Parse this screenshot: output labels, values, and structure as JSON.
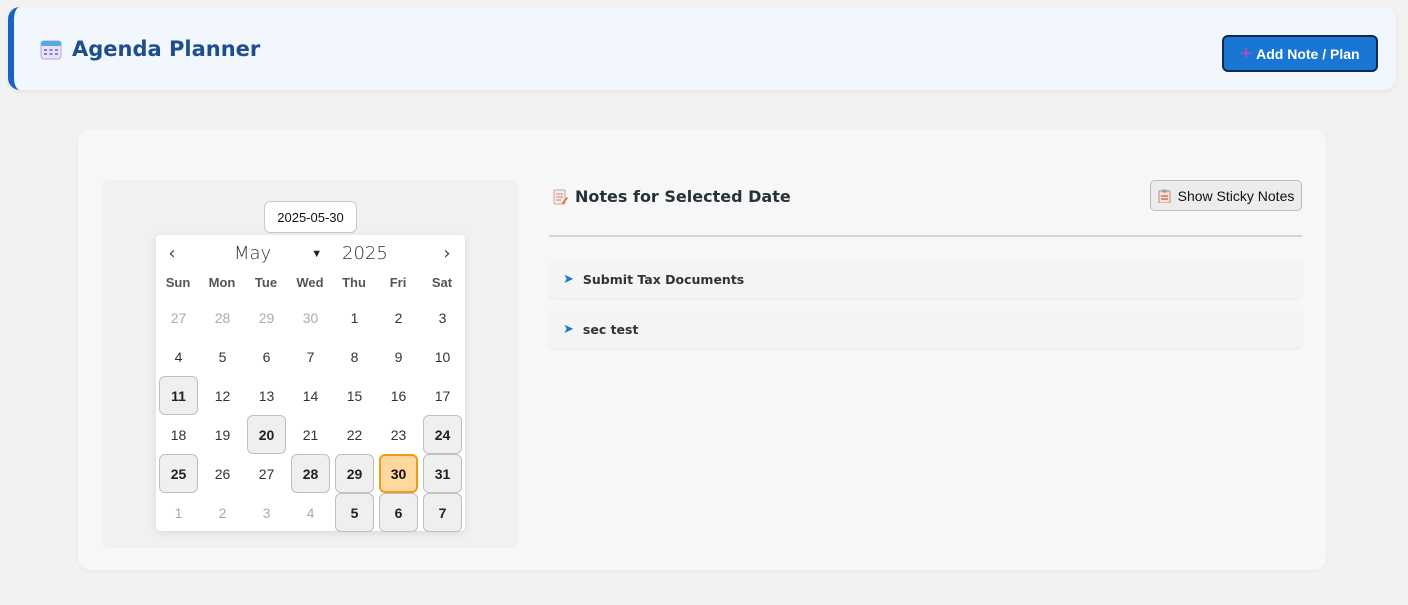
{
  "header": {
    "title": "Agenda Planner",
    "add_button_icon": "+",
    "add_button_label": "Add Note / Plan"
  },
  "calendar": {
    "date_input_value": "2025-05-30",
    "prev_icon": "‹",
    "next_icon": "›",
    "month": "May",
    "month_caret": "⌄",
    "year": "2025",
    "weekdays": [
      "Sun",
      "Mon",
      "Tue",
      "Wed",
      "Thu",
      "Fri",
      "Sat"
    ],
    "weeks": [
      [
        {
          "d": "27",
          "s": "muted"
        },
        {
          "d": "28",
          "s": "muted"
        },
        {
          "d": "29",
          "s": "muted"
        },
        {
          "d": "30",
          "s": "muted"
        },
        {
          "d": "1",
          "s": ""
        },
        {
          "d": "2",
          "s": ""
        },
        {
          "d": "3",
          "s": ""
        }
      ],
      [
        {
          "d": "4",
          "s": ""
        },
        {
          "d": "5",
          "s": ""
        },
        {
          "d": "6",
          "s": ""
        },
        {
          "d": "7",
          "s": ""
        },
        {
          "d": "8",
          "s": ""
        },
        {
          "d": "9",
          "s": ""
        },
        {
          "d": "10",
          "s": ""
        }
      ],
      [
        {
          "d": "11",
          "s": "marked"
        },
        {
          "d": "12",
          "s": ""
        },
        {
          "d": "13",
          "s": ""
        },
        {
          "d": "14",
          "s": ""
        },
        {
          "d": "15",
          "s": ""
        },
        {
          "d": "16",
          "s": ""
        },
        {
          "d": "17",
          "s": ""
        }
      ],
      [
        {
          "d": "18",
          "s": ""
        },
        {
          "d": "19",
          "s": ""
        },
        {
          "d": "20",
          "s": "marked"
        },
        {
          "d": "21",
          "s": ""
        },
        {
          "d": "22",
          "s": ""
        },
        {
          "d": "23",
          "s": ""
        },
        {
          "d": "24",
          "s": "marked"
        }
      ],
      [
        {
          "d": "25",
          "s": "marked"
        },
        {
          "d": "26",
          "s": ""
        },
        {
          "d": "27",
          "s": ""
        },
        {
          "d": "28",
          "s": "marked"
        },
        {
          "d": "29",
          "s": "marked"
        },
        {
          "d": "30",
          "s": "selected"
        },
        {
          "d": "31",
          "s": "marked"
        }
      ],
      [
        {
          "d": "1",
          "s": "muted"
        },
        {
          "d": "2",
          "s": "muted"
        },
        {
          "d": "3",
          "s": "muted"
        },
        {
          "d": "4",
          "s": "muted"
        },
        {
          "d": "5",
          "s": "marked"
        },
        {
          "d": "6",
          "s": "marked"
        },
        {
          "d": "7",
          "s": "marked"
        }
      ]
    ]
  },
  "notes": {
    "title": "Notes for Selected Date",
    "sticky_button_label": "Show Sticky Notes",
    "item_icon": "➤",
    "items": [
      "Submit Tax Documents",
      "sec test"
    ]
  },
  "colors": {
    "accent": "#1976d2",
    "header_border": "#1565c0",
    "selected_day_bg": "#ffd89e",
    "selected_day_border": "#f29a1a"
  }
}
